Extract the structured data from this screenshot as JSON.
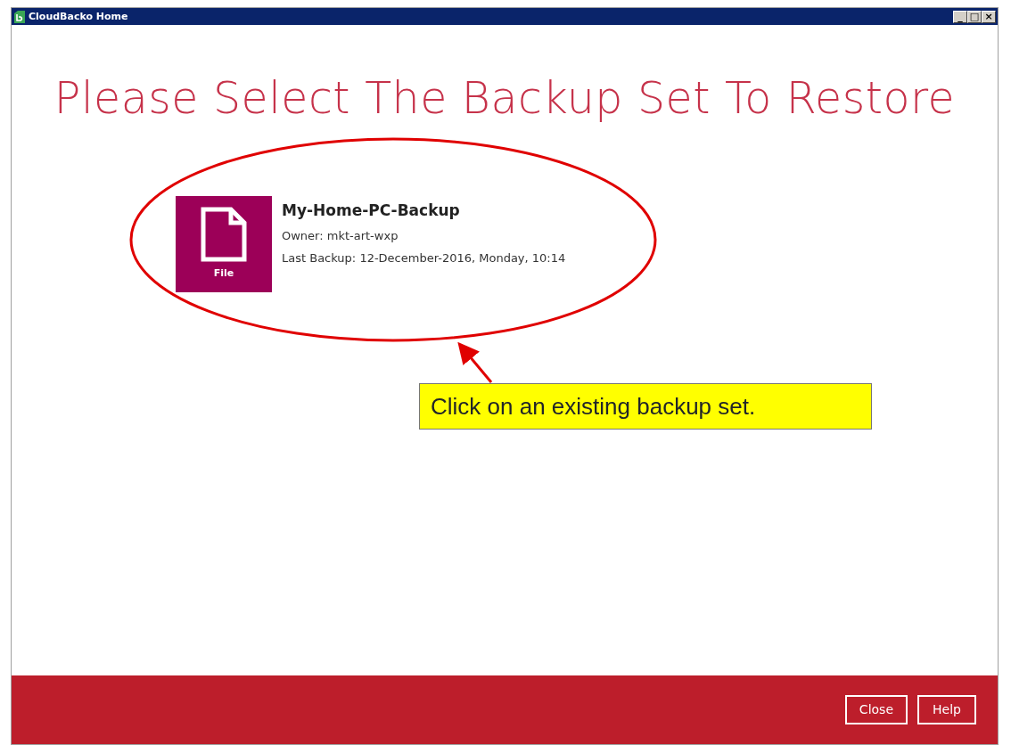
{
  "window": {
    "title": "CloudBacko Home",
    "controls": [
      "_",
      "□",
      "×"
    ]
  },
  "heading": "Please Select The Backup Set To Restore",
  "backup_sets": [
    {
      "type_label": "File",
      "name": "My-Home-PC-Backup",
      "owner": "Owner: mkt-art-wxp",
      "last_backup": "Last Backup: 12-December-2016, Monday, 10:14"
    }
  ],
  "annotation": {
    "text": "Click on an existing backup set."
  },
  "buttons": [
    "Close",
    "Help"
  ]
}
